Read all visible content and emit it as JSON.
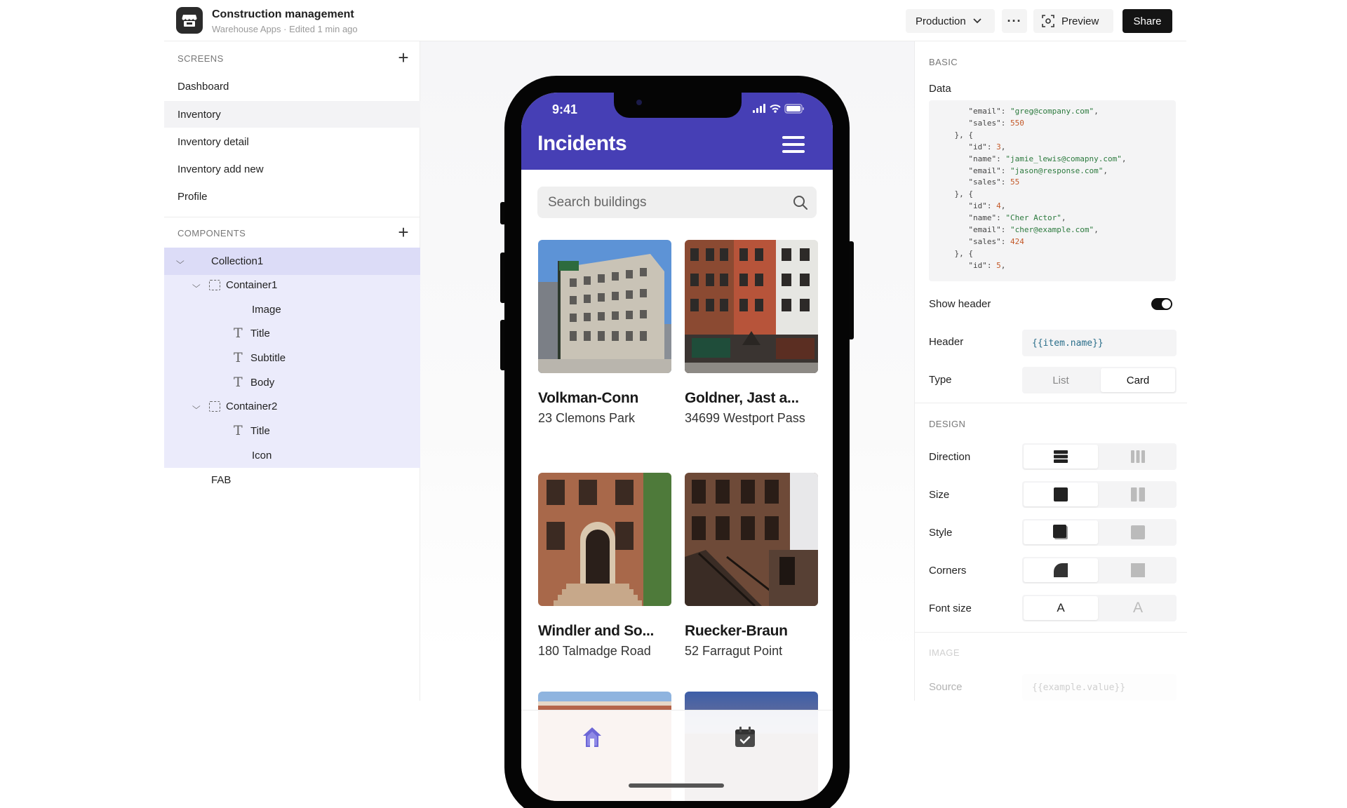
{
  "topbar": {
    "app_title": "Construction management",
    "app_subtitle": "Warehouse Apps · Edited 1 min ago",
    "environment": "Production",
    "more": "···",
    "preview": "Preview",
    "share": "Share"
  },
  "screens": {
    "heading": "SCREENS",
    "items": [
      "Dashboard",
      "Inventory",
      "Inventory detail",
      "Inventory add new",
      "Profile"
    ],
    "active": "Inventory"
  },
  "components": {
    "heading": "COMPONENTS",
    "tree": {
      "collection": "Collection1",
      "container1": "Container1",
      "image": "Image",
      "title1": "Title",
      "subtitle": "Subtitle",
      "body": "Body",
      "container2": "Container2",
      "title2": "Title",
      "icon": "Icon",
      "fab": "FAB"
    }
  },
  "phone": {
    "time": "9:41",
    "title": "Incidents",
    "search_placeholder": "Search buildings",
    "cards": [
      {
        "title": "Volkman-Conn",
        "subtitle": "23 Clemons Park"
      },
      {
        "title": "Goldner, Jast a...",
        "subtitle": "34699 Westport Pass"
      },
      {
        "title": "Windler and So...",
        "subtitle": "180 Talmadge Road"
      },
      {
        "title": "Ruecker-Braun",
        "subtitle": "52 Farragut Point"
      }
    ],
    "accent": "#463fb5"
  },
  "properties": {
    "basic_heading": "BASIC",
    "data_label": "Data",
    "show_header_label": "Show header",
    "show_header_on": true,
    "header_label": "Header",
    "header_value": "{{item.name}}",
    "type_label": "Type",
    "type_options": [
      "List",
      "Card"
    ],
    "type_selected": "Card",
    "design_heading": "DESIGN",
    "direction_label": "Direction",
    "size_label": "Size",
    "style_label": "Style",
    "corners_label": "Corners",
    "font_size_label": "Font size",
    "font_size_options": [
      "A",
      "A"
    ],
    "image_heading": "IMAGE",
    "source_label": "Source",
    "source_value": "{{example.value}}"
  }
}
